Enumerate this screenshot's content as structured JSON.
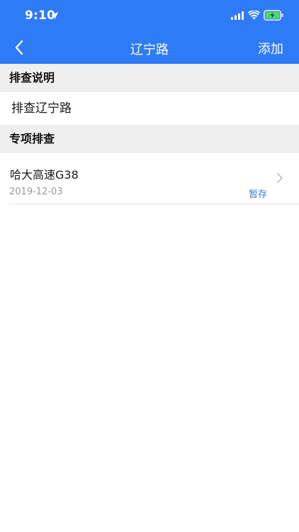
{
  "status_bar": {
    "time": "9:10",
    "icons": [
      "location-arrow-icon",
      "signal-icon",
      "wifi-icon",
      "battery-charging-icon"
    ]
  },
  "nav": {
    "title": "辽宁路",
    "add_label": "添加",
    "back_icon": "chevron-left-icon"
  },
  "sections": {
    "description": {
      "header": "排查说明",
      "text": "排查辽宁路"
    },
    "special": {
      "header": "专项排查",
      "items": [
        {
          "title": "哈大高速G38",
          "date": "2019-12-03",
          "status": "暂存"
        }
      ]
    }
  },
  "colors": {
    "header_bg": "#2f7bf6",
    "section_bg": "#efefef",
    "status_accent": "#3a7bd5",
    "battery_fill": "#4cd964"
  }
}
